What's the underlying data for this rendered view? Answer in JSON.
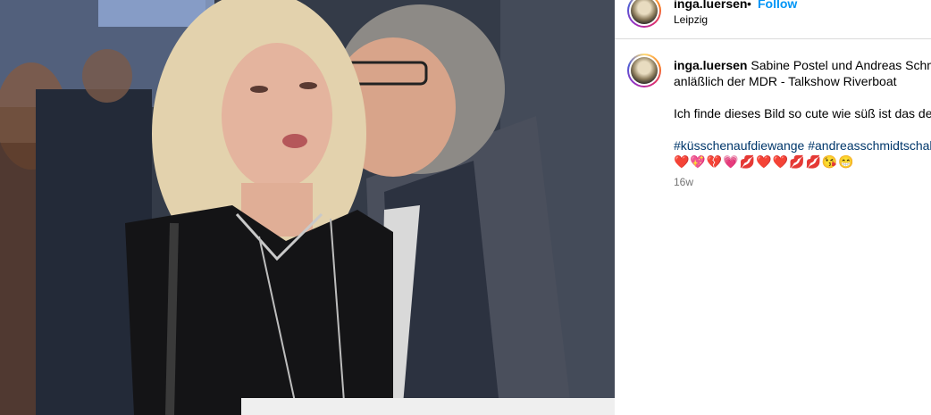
{
  "post": {
    "username": "inga.luersen",
    "separator": "•",
    "follow_label": "Follow",
    "location": "Leipzig"
  },
  "caption": {
    "username": "inga.luersen",
    "line1": "Sabine Postel und Andreas Schmi",
    "line2": "anläßlich der MDR - Talkshow Riverboat",
    "line3": "Ich finde dieses Bild so cute wie süß ist das der",
    "hashtags": "#küsschenaufdiewange #andreasschmidtschall",
    "emojis": "❤️💖💔💗💋❤️❤️💋💋😘😁",
    "timestamp": "16w"
  },
  "icons": {
    "photo": "post-photo",
    "avatar": "profile-avatar"
  },
  "colors": {
    "follow": "#0095f6",
    "hashtag": "#00376b",
    "muted": "#737373"
  }
}
